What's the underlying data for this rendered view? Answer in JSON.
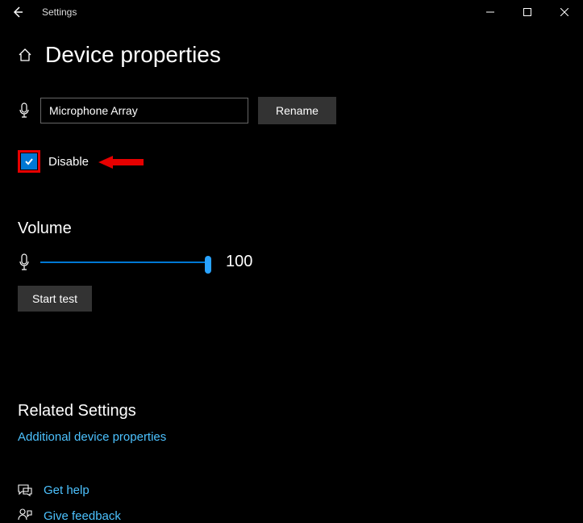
{
  "app": {
    "title": "Settings"
  },
  "page": {
    "title": "Device properties"
  },
  "device": {
    "name": "Microphone Array",
    "rename_label": "Rename",
    "disable_label": "Disable",
    "disable_checked": true
  },
  "volume": {
    "heading": "Volume",
    "value": "100",
    "percent": 100,
    "start_test_label": "Start test"
  },
  "related": {
    "heading": "Related Settings",
    "additional_props_label": "Additional device properties"
  },
  "help": {
    "get_help_label": "Get help",
    "feedback_label": "Give feedback"
  },
  "annotation": {
    "highlight": "disable-checkbox",
    "arrow_color": "#e60000"
  }
}
